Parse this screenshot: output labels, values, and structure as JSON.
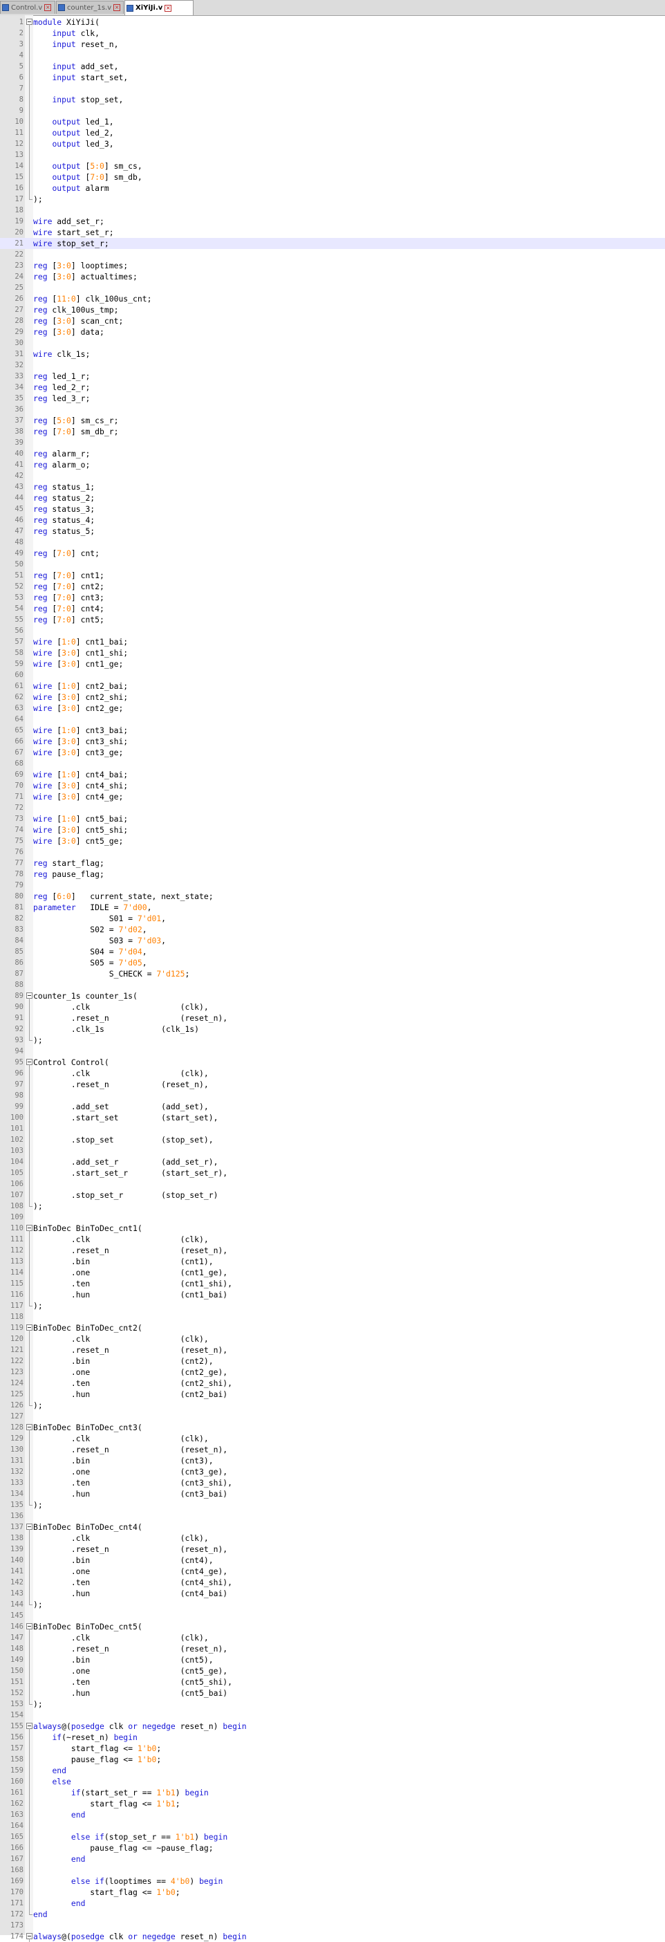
{
  "tabs": [
    {
      "label": "Control.v",
      "active": false
    },
    {
      "label": "counter_1s.v",
      "active": false
    },
    {
      "label": "XiYiJi.v",
      "active": true
    }
  ],
  "editor": {
    "current_line": 21,
    "lines": [
      "module XiYiJi(",
      "    input clk,",
      "    input reset_n,",
      "",
      "    input add_set,",
      "    input start_set,",
      "",
      "    input stop_set,",
      "",
      "    output led_1,",
      "    output led_2,",
      "    output led_3,",
      "",
      "    output [5:0] sm_cs,",
      "    output [7:0] sm_db,",
      "    output alarm",
      ");",
      "",
      "wire add_set_r;",
      "wire start_set_r;",
      "wire stop_set_r;",
      "",
      "reg [3:0] looptimes;",
      "reg [3:0] actualtimes;",
      "",
      "reg [11:0] clk_100us_cnt;",
      "reg clk_100us_tmp;",
      "reg [3:0] scan_cnt;",
      "reg [3:0] data;",
      "",
      "wire clk_1s;",
      "",
      "reg led_1_r;",
      "reg led_2_r;",
      "reg led_3_r;",
      "",
      "reg [5:0] sm_cs_r;",
      "reg [7:0] sm_db_r;",
      "",
      "reg alarm_r;",
      "reg alarm_o;",
      "",
      "reg status_1;",
      "reg status_2;",
      "reg status_3;",
      "reg status_4;",
      "reg status_5;",
      "",
      "reg [7:0] cnt;",
      "",
      "reg [7:0] cnt1;",
      "reg [7:0] cnt2;",
      "reg [7:0] cnt3;",
      "reg [7:0] cnt4;",
      "reg [7:0] cnt5;",
      "",
      "wire [1:0] cnt1_bai;",
      "wire [3:0] cnt1_shi;",
      "wire [3:0] cnt1_ge;",
      "",
      "wire [1:0] cnt2_bai;",
      "wire [3:0] cnt2_shi;",
      "wire [3:0] cnt2_ge;",
      "",
      "wire [1:0] cnt3_bai;",
      "wire [3:0] cnt3_shi;",
      "wire [3:0] cnt3_ge;",
      "",
      "wire [1:0] cnt4_bai;",
      "wire [3:0] cnt4_shi;",
      "wire [3:0] cnt4_ge;",
      "",
      "wire [1:0] cnt5_bai;",
      "wire [3:0] cnt5_shi;",
      "wire [3:0] cnt5_ge;",
      "",
      "reg start_flag;",
      "reg pause_flag;",
      "",
      "reg [6:0]   current_state, next_state;",
      "parameter   IDLE = 7'd00,",
      "                S01 = 7'd01,",
      "            S02 = 7'd02,",
      "                S03 = 7'd03,",
      "            S04 = 7'd04,",
      "            S05 = 7'd05,",
      "                S_CHECK = 7'd125;",
      "",
      "counter_1s counter_1s(",
      "        .clk                   (clk),",
      "        .reset_n               (reset_n),",
      "        .clk_1s            (clk_1s)",
      ");",
      "",
      "Control Control(",
      "        .clk                   (clk),",
      "        .reset_n           (reset_n),",
      "",
      "        .add_set           (add_set),",
      "        .start_set         (start_set),",
      "",
      "        .stop_set          (stop_set),",
      "",
      "        .add_set_r         (add_set_r),",
      "        .start_set_r       (start_set_r),",
      "",
      "        .stop_set_r        (stop_set_r)",
      ");",
      "",
      "BinToDec BinToDec_cnt1(",
      "        .clk                   (clk),",
      "        .reset_n               (reset_n),",
      "        .bin                   (cnt1),",
      "        .one                   (cnt1_ge),",
      "        .ten                   (cnt1_shi),",
      "        .hun                   (cnt1_bai)",
      ");",
      "",
      "BinToDec BinToDec_cnt2(",
      "        .clk                   (clk),",
      "        .reset_n               (reset_n),",
      "        .bin                   (cnt2),",
      "        .one                   (cnt2_ge),",
      "        .ten                   (cnt2_shi),",
      "        .hun                   (cnt2_bai)",
      ");",
      "",
      "BinToDec BinToDec_cnt3(",
      "        .clk                   (clk),",
      "        .reset_n               (reset_n),",
      "        .bin                   (cnt3),",
      "        .one                   (cnt3_ge),",
      "        .ten                   (cnt3_shi),",
      "        .hun                   (cnt3_bai)",
      ");",
      "",
      "BinToDec BinToDec_cnt4(",
      "        .clk                   (clk),",
      "        .reset_n               (reset_n),",
      "        .bin                   (cnt4),",
      "        .one                   (cnt4_ge),",
      "        .ten                   (cnt4_shi),",
      "        .hun                   (cnt4_bai)",
      ");",
      "",
      "BinToDec BinToDec_cnt5(",
      "        .clk                   (clk),",
      "        .reset_n               (reset_n),",
      "        .bin                   (cnt5),",
      "        .one                   (cnt5_ge),",
      "        .ten                   (cnt5_shi),",
      "        .hun                   (cnt5_bai)",
      ");",
      "",
      "always@(posedge clk or negedge reset_n) begin",
      "    if(~reset_n) begin",
      "        start_flag <= 1'b0;",
      "        pause_flag <= 1'b0;",
      "    end",
      "    else",
      "        if(start_set_r == 1'b1) begin",
      "            start_flag <= 1'b1;",
      "        end",
      "",
      "        else if(stop_set_r == 1'b1) begin",
      "            pause_flag <= ~pause_flag;",
      "        end",
      "",
      "        else if(looptimes == 4'b0) begin",
      "            start_flag <= 1'b0;",
      "        end",
      "end",
      "",
      "always@(posedge clk or negedge reset_n) begin"
    ]
  }
}
